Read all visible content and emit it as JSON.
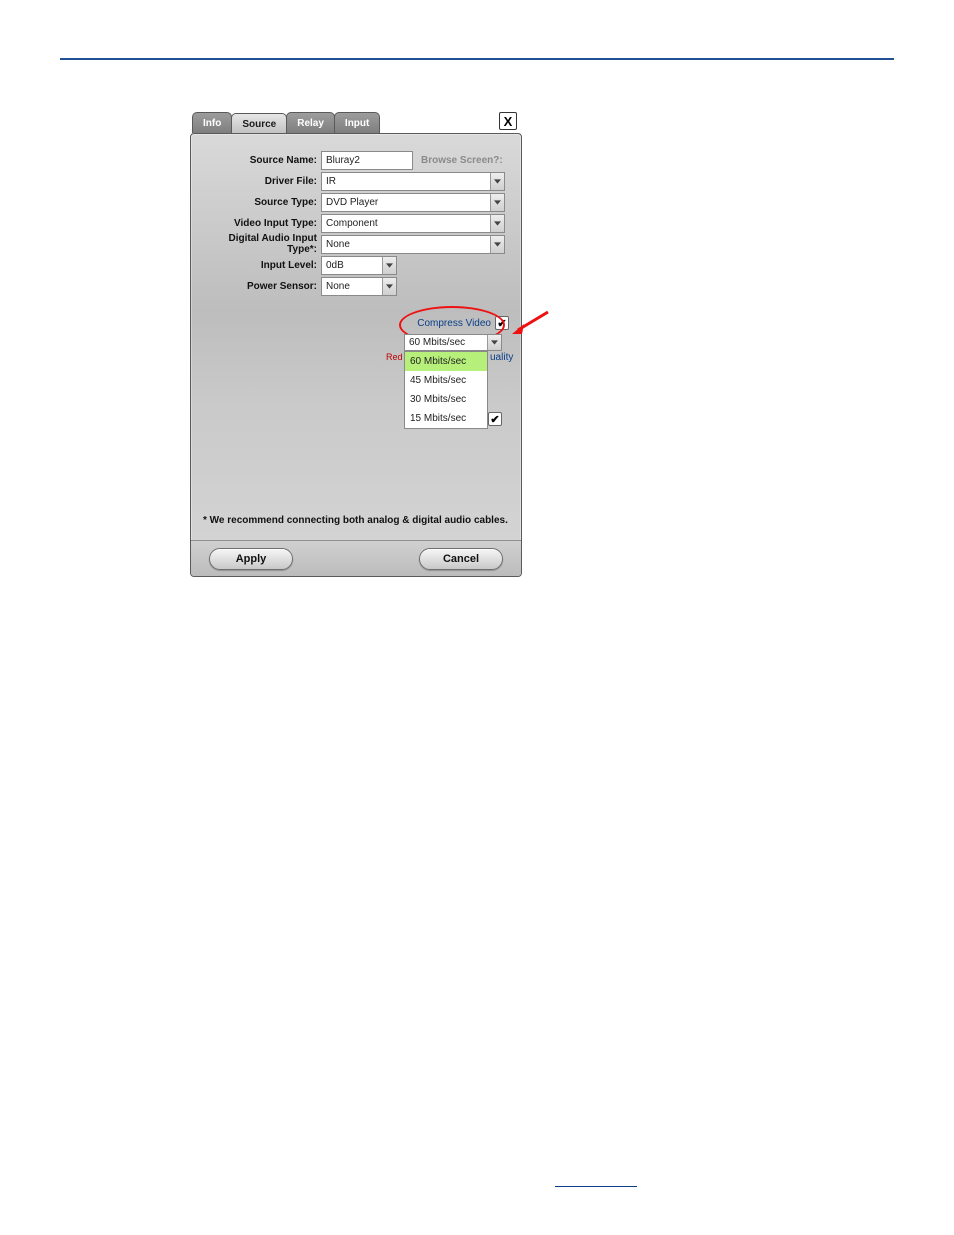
{
  "tabs": {
    "info": "Info",
    "source": "Source",
    "relay": "Relay",
    "input": "Input"
  },
  "labels": {
    "source_name": "Source Name:",
    "driver_file": "Driver File:",
    "source_type": "Source Type:",
    "video_input_type": "Video Input Type:",
    "digital_audio_input_type": "Digital Audio Input Type*:",
    "input_level": "Input Level:",
    "power_sensor": "Power Sensor:",
    "browse_screen": "Browse Screen?:"
  },
  "values": {
    "source_name": "Bluray2",
    "driver_file": "IR",
    "source_type": "DVD Player",
    "video_input_type": "Component",
    "digital_audio_input_type": "None",
    "input_level": "0dB",
    "power_sensor": "None"
  },
  "compress": {
    "label": "Compress Video",
    "selected": "60 Mbits/sec",
    "red_hint": "Red",
    "options": [
      "60 Mbits/sec",
      "45 Mbits/sec",
      "30 Mbits/sec",
      "15 Mbits/sec"
    ],
    "uality_fragment": "uality"
  },
  "footnote": "* We recommend connecting both analog & digital audio cables.",
  "buttons": {
    "apply": "Apply",
    "cancel": "Cancel",
    "close": "X"
  },
  "checkmark": "✔"
}
